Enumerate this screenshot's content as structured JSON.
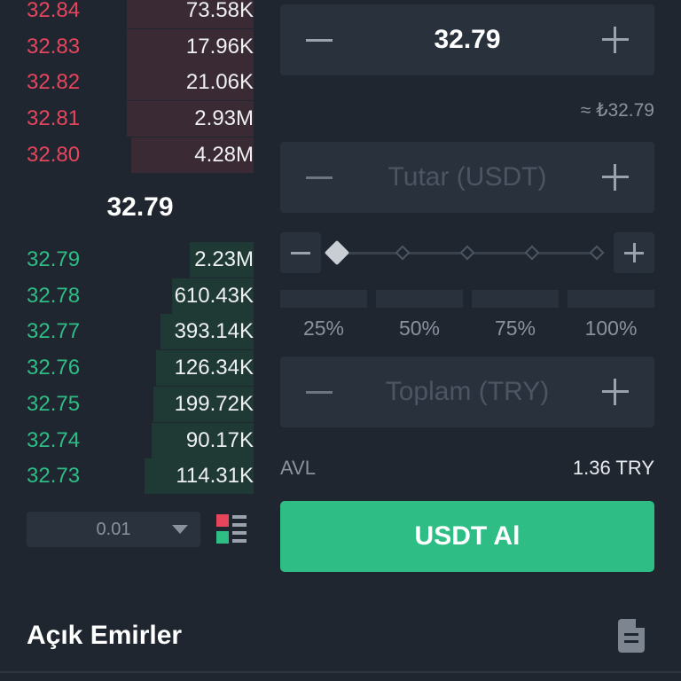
{
  "orderbook": {
    "asks": [
      {
        "price": "32.84",
        "amount": "73.58K",
        "depth": 0.56
      },
      {
        "price": "32.83",
        "amount": "17.96K",
        "depth": 0.56
      },
      {
        "price": "32.82",
        "amount": "21.06K",
        "depth": 0.56
      },
      {
        "price": "32.81",
        "amount": "2.93M",
        "depth": 0.56
      },
      {
        "price": "32.80",
        "amount": "4.28M",
        "depth": 0.54
      }
    ],
    "last_price": "32.79",
    "bids": [
      {
        "price": "32.79",
        "amount": "2.23M",
        "depth": 0.28
      },
      {
        "price": "32.78",
        "amount": "610.43K",
        "depth": 0.36
      },
      {
        "price": "32.77",
        "amount": "393.14K",
        "depth": 0.41
      },
      {
        "price": "32.76",
        "amount": "126.34K",
        "depth": 0.43
      },
      {
        "price": "32.75",
        "amount": "199.72K",
        "depth": 0.44
      },
      {
        "price": "32.74",
        "amount": "90.17K",
        "depth": 0.45
      },
      {
        "price": "32.73",
        "amount": "114.31K",
        "depth": 0.48
      }
    ],
    "precision": "0.01"
  },
  "form": {
    "price": "32.79",
    "approx_price": "≈ ₺32.79",
    "amount_placeholder": "Tutar (USDT)",
    "slider_level": 0,
    "percentages": [
      "25%",
      "50%",
      "75%",
      "100%"
    ],
    "total_placeholder": "Toplam (TRY)",
    "available_label": "AVL",
    "available_value": "1.36 TRY",
    "buy_label": "USDT Al"
  },
  "open_orders": {
    "title": "Açık Emirler"
  },
  "colors": {
    "ask": "#e6455c",
    "bid": "#2ebd85",
    "buy_button": "#2ebd85",
    "background": "#1f2630"
  },
  "icons": [
    "chevron-down-icon",
    "orderbook-layout-icon",
    "minus-icon",
    "plus-icon",
    "document-icon"
  ]
}
